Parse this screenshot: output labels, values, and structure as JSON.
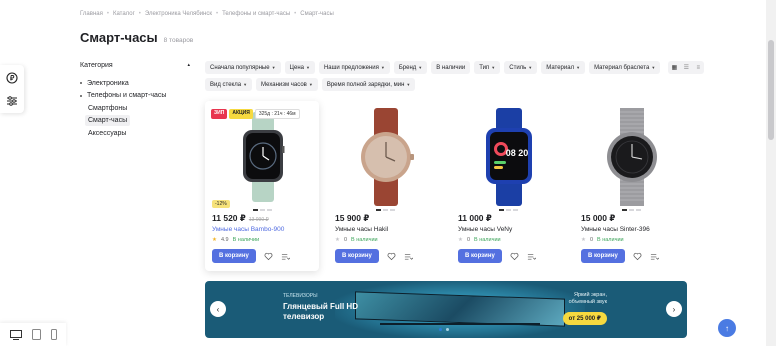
{
  "breadcrumb": [
    "Главная",
    "Каталог",
    "Электроника Челябинск",
    "Телефоны и смарт-часы",
    "Смарт-часы"
  ],
  "page": {
    "title": "Смарт-часы",
    "count": "8 товаров"
  },
  "category": {
    "heading": "Категория",
    "toggle": "▴",
    "items": [
      {
        "label": "Электроника"
      },
      {
        "label": "Телефоны и смарт-часы"
      }
    ],
    "subitems": [
      {
        "label": "Смартфоны"
      },
      {
        "label": "Смарт-часы"
      },
      {
        "label": "Аксессуары"
      }
    ]
  },
  "filters": {
    "row1": [
      "Сначала популярные",
      "Цена",
      "Наши предложения",
      "Бренд",
      "В наличии",
      "Тип",
      "Стиль",
      "Материал",
      "Материал браслета"
    ],
    "row2": [
      "Вид стекла",
      "Механизм часов",
      "Время полной зарядки, мин"
    ]
  },
  "products": [
    {
      "badge1": "ЗИП",
      "badge2": "АКЦИЯ",
      "timer": "325д : 21ч : 46м",
      "discount": "-12%",
      "price": "11 520 ₽",
      "old_price": "13 090 ₽",
      "name": "Умные часы Bambo-900",
      "rating": "4.9",
      "stock": "В наличии",
      "button": "В корзину"
    },
    {
      "price": "15 900 ₽",
      "name": "Умные часы Hakil",
      "rating": "0",
      "stock": "В наличии",
      "button": "В корзину"
    },
    {
      "price": "11 000 ₽",
      "name": "Умные часы VeNy",
      "rating": "0",
      "stock": "В наличии",
      "button": "В корзину"
    },
    {
      "price": "15 000 ₽",
      "name": "Умные часы Sinter-396",
      "rating": "0",
      "stock": "В наличии",
      "button": "В корзину"
    }
  ],
  "banner": {
    "category": "ТЕЛЕВИЗОРЫ",
    "title": "Глянцевый Full HD телевизор",
    "desc": "Яркий экран, объемный звук",
    "price": "от 25 000 ₽",
    "clock_face": "08 20"
  },
  "colors": {
    "accent": "#5470e0",
    "stock_green": "#3ea55b",
    "banner_bg": "#1a5b77",
    "yellow": "#f6d93f"
  }
}
